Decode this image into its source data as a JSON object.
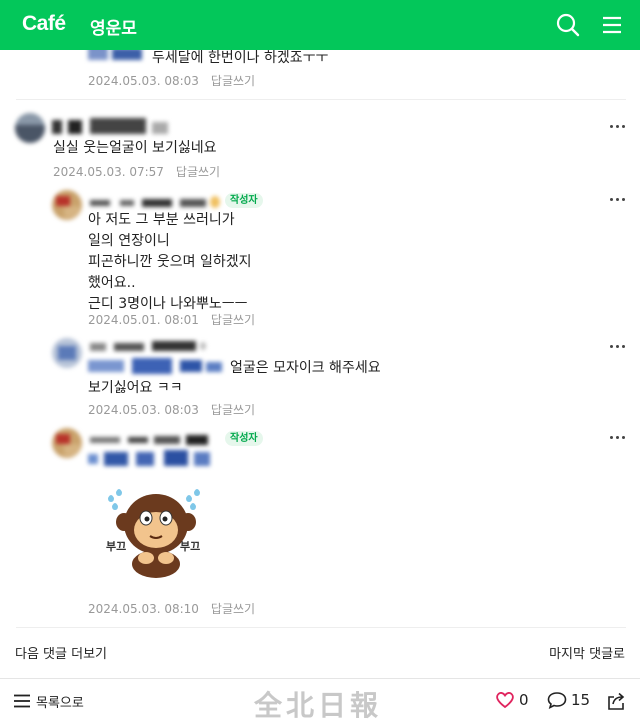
{
  "header": {
    "logo": "Café",
    "cafe_name": "영운모",
    "search_icon": "search-icon",
    "menu_icon": "hamburger-menu-icon"
  },
  "comments": [
    {
      "lines": [
        "두세달에 한번이나 하겠죠ㅜㅜ"
      ],
      "date": "2024.05.03. 08:03",
      "reply_label": "답글쓰기"
    },
    {
      "lines": [
        "실실 웃는얼굴이 보기싫네요"
      ],
      "date": "2024.05.03. 07:57",
      "reply_label": "답글쓰기"
    },
    {
      "badge": "작성자",
      "lines": [
        "아 저도 그 부분 쓰러니가",
        "일의 연장이니",
        "피곤하니깐 웃으며 일하겠지",
        "했어요..",
        "근디 3명이나 나와뿌노ㅡㅡ"
      ],
      "date": "2024.05.01. 08:01",
      "reply_label": "답글쓰기"
    },
    {
      "lines": [
        "얼굴은 모자이크 해주세요",
        "보기싫어요 ㅋㅋ"
      ],
      "date": "2024.05.03. 08:03",
      "reply_label": "답글쓰기"
    },
    {
      "badge": "작성자",
      "sticker_text_left": "부끄",
      "sticker_text_right": "부끄",
      "date": "2024.05.03. 08:10",
      "reply_label": "답글쓰기"
    }
  ],
  "links": {
    "next_comments": "다음 댓글 더보기",
    "last_comment": "마지막 댓글로"
  },
  "bottom": {
    "list_label": "목록으로",
    "like_count": "0",
    "comment_count": "15",
    "watermark": "全北日報"
  },
  "colors": {
    "brand": "#03c75a",
    "like": "#e0245e"
  }
}
